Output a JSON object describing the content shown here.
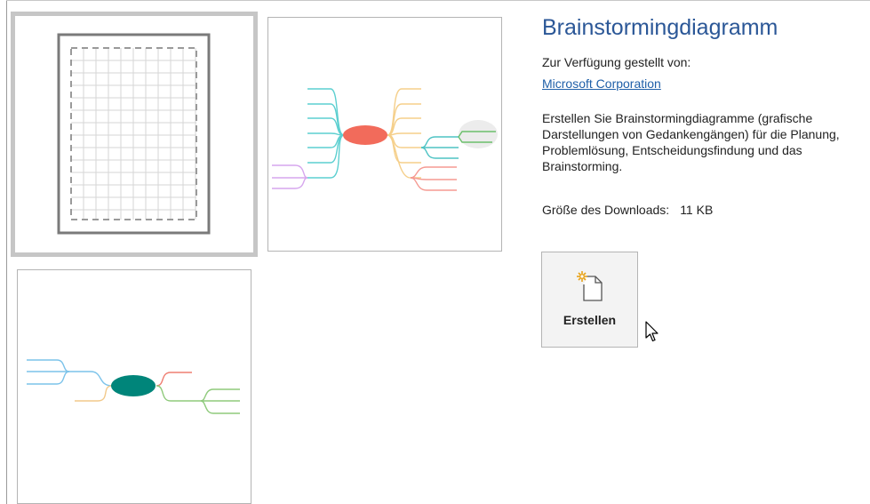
{
  "template": {
    "title": "Brainstormingdiagramm",
    "provided_by_label": "Zur Verfügung gestellt von:",
    "provider_name": "Microsoft Corporation",
    "description": "Erstellen Sie Brainstormingdiagramme (grafische Darstellungen von Gedankengängen) für die Planung, Problemlösung, Entscheidungsfindung und das Brainstorming.",
    "download_size_label": "Größe des Downloads:",
    "download_size_value": "11 KB"
  },
  "actions": {
    "create_label": "Erstellen"
  },
  "thumbnails": [
    {
      "name": "blank-grid-template",
      "selected": true
    },
    {
      "name": "colorful-mindmap-template",
      "selected": false,
      "center_color": "#f26b5b"
    },
    {
      "name": "teal-mindmap-template",
      "selected": false,
      "center_color": "#00857a"
    }
  ],
  "colors": {
    "title": "#2b5797",
    "link": "#1f5fa8",
    "selection_border": "#c6c6c6"
  }
}
